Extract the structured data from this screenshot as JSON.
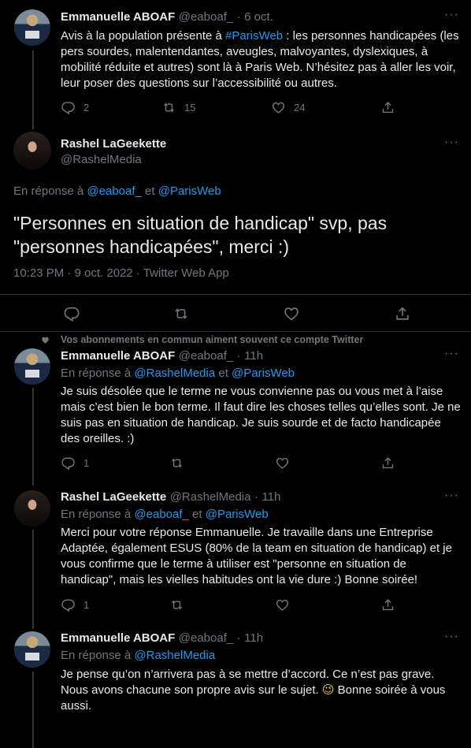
{
  "tweet1": {
    "name": "Emmanuelle ABOAF",
    "handle": "@eaboaf_",
    "sep": "·",
    "date": "6 oct.",
    "text_before": "Avis à la population présente à ",
    "hashtag": "#ParisWeb",
    "text_after": " : les personnes handicapées (les pers sourdes, malentendantes, aveugles, malvoyantes, dyslexiques, à mobilité réduite et autres) sont là à Paris Web. N’hésitez pas à aller les voir, leur poser des questions sur l’accessibilité ou autres.",
    "replies": "2",
    "retweets": "15",
    "likes": "24"
  },
  "main": {
    "name": "Rashel LaGeekette",
    "handle": "@RashelMedia",
    "reply_prefix": "En réponse à",
    "reply_to_1": "@eaboaf_",
    "reply_and": "et",
    "reply_to_2": "@ParisWeb",
    "text": "\"Personnes en situation de handicap\" svp, pas \"personnes handicapées\", merci :)",
    "time": "10:23 PM · 9 oct. 2022 · Twitter Web App"
  },
  "social_context": "Vos abonnements en commun aiment souvent ce compte Twitter",
  "reply1": {
    "name": "Emmanuelle ABOAF",
    "handle": "@eaboaf_",
    "sep": "·",
    "date": "11h",
    "reply_prefix": "En réponse à",
    "reply_to_1": "@RashelMedia",
    "reply_and": "et",
    "reply_to_2": "@ParisWeb",
    "text": "Je suis désolée que le terme ne vous convienne pas ou vous met à l’aise mais c’est bien le bon terme. Il faut dire les choses telles qu’elles sont. Je ne suis pas en situation de handicap. Je suis sourde et de facto handicapée des oreilles. :)",
    "replies": "1"
  },
  "reply2": {
    "name": "Rashel LaGeekette",
    "handle": "@RashelMedia",
    "sep": "·",
    "date": "11h",
    "reply_prefix": "En réponse à",
    "reply_to_1": "@eaboaf_",
    "reply_and": "et",
    "reply_to_2": "@ParisWeb",
    "text": "Merci pour votre réponse Emmanuelle. Je travaille dans une Entreprise Adaptée, également ESUS (80% de la team en situation de handicap) et je vous confirme que le terme à utiliser est \"personne en situation de handicap\", mais les vielles habitudes ont la vie dure :) Bonne soirée!",
    "replies": "1"
  },
  "reply3": {
    "name": "Emmanuelle ABOAF",
    "handle": "@eaboaf_",
    "sep": "·",
    "date": "11h",
    "reply_prefix": "En réponse à",
    "reply_to_1": "@RashelMedia",
    "text_before": "Je pense qu’on n’arrivera pas à se mettre d’accord. Ce n’est pas grave. Nous avons chacune son propre avis sur le sujet. ",
    "emoji": "😉",
    "text_after": " Bonne soirée à vous aussi."
  },
  "icons": {
    "reply": "reply-icon",
    "retweet": "retweet-icon",
    "like": "heart-icon",
    "share": "share-icon",
    "more": "more-icon"
  },
  "colors": {
    "link": "#1d9bf0",
    "muted": "#71767b",
    "text": "#e7e9ea",
    "bg": "#000000"
  }
}
